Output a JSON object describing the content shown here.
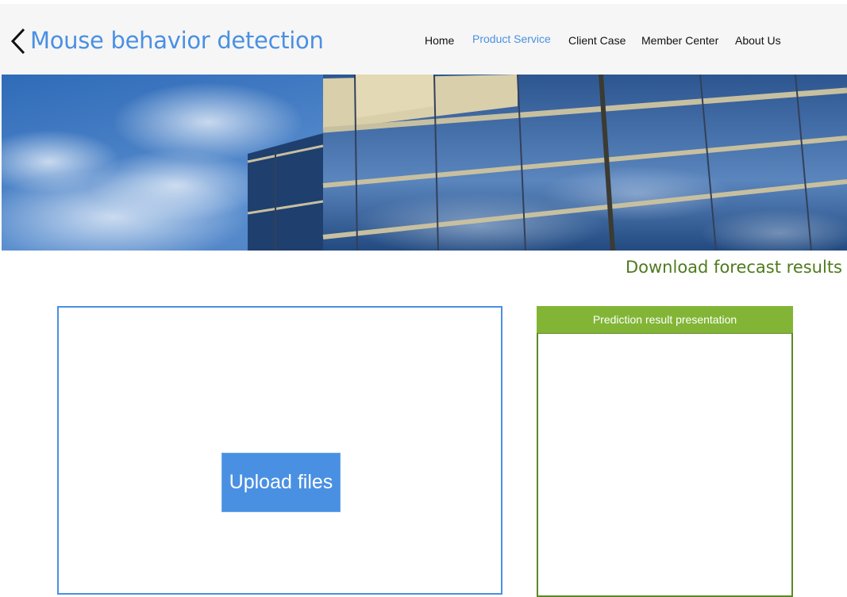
{
  "header": {
    "title": "Mouse behavior detection",
    "back_icon": "chevron-left-icon"
  },
  "nav": {
    "items": [
      {
        "label": "Home",
        "active": false
      },
      {
        "label": "Product Service",
        "active": true
      },
      {
        "label": "Client Case",
        "active": false
      },
      {
        "label": "Member Center",
        "active": false
      },
      {
        "label": "About Us",
        "active": false
      }
    ]
  },
  "main": {
    "download_label": "Download forecast results",
    "upload_label": "Upload files",
    "result_title": "Prediction result presentation"
  },
  "colors": {
    "accent_blue": "#4a90e2",
    "accent_green": "#82b536",
    "dark_green": "#4f7a1e",
    "header_bg": "#f6f6f6"
  }
}
